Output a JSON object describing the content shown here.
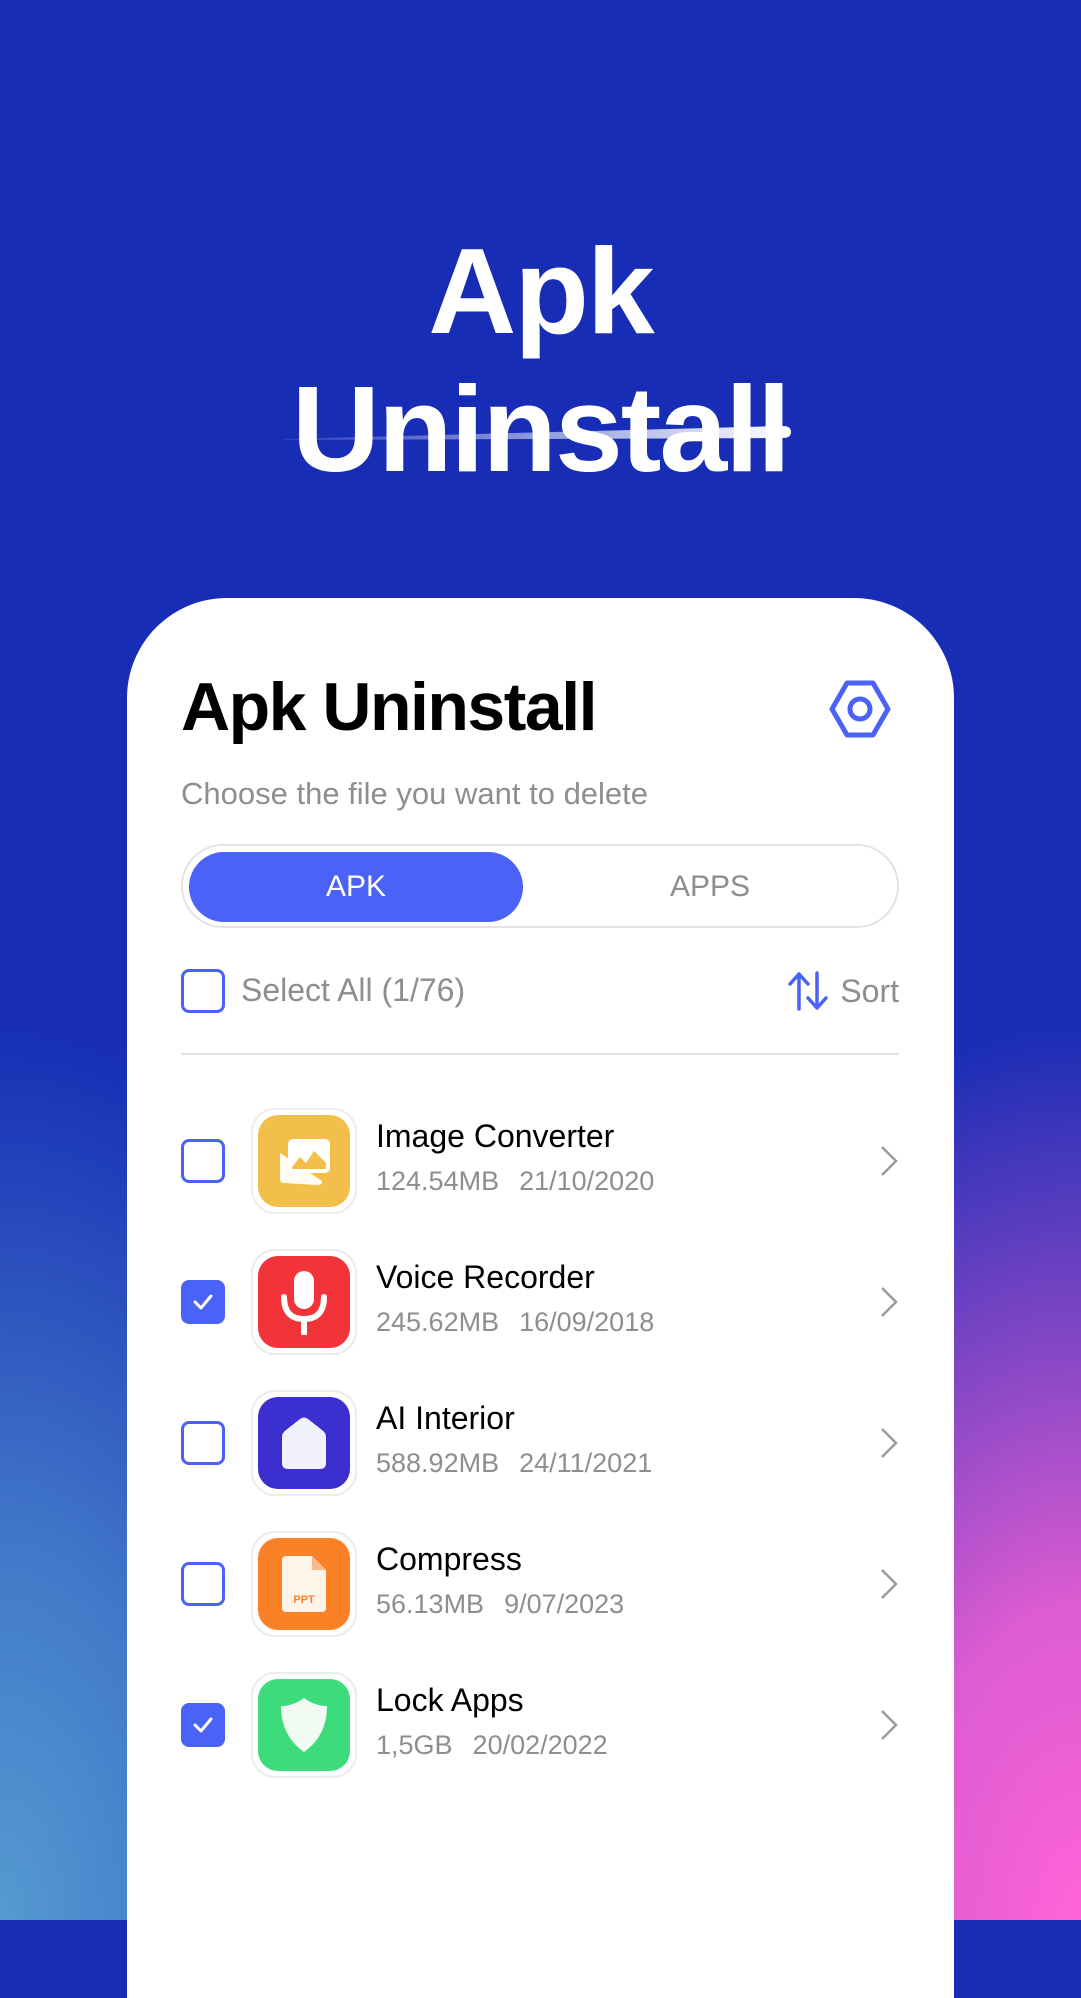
{
  "hero": {
    "title_line1": "Apk",
    "title_line2": "Uninstall"
  },
  "header": {
    "title": "Apk Uninstall",
    "subtitle": "Choose the file you want to delete",
    "settings_icon": "settings-hex-icon"
  },
  "tabs": [
    {
      "label": "APK",
      "active": true
    },
    {
      "label": "APPS",
      "active": false
    }
  ],
  "toolbar": {
    "select_all_label": "Select All (1/76)",
    "select_all_checked": false,
    "sort_label": "Sort",
    "sort_icon": "sort-arrows-icon"
  },
  "apps": [
    {
      "name": "Image Converter",
      "size": "124.54MB",
      "date": "21/10/2020",
      "checked": false,
      "icon": "image-gallery-icon",
      "color": "#f2c04a"
    },
    {
      "name": "Voice Recorder",
      "size": "245.62MB",
      "date": "16/09/2018",
      "checked": true,
      "icon": "microphone-icon",
      "color": "#f2333a"
    },
    {
      "name": "AI Interior",
      "size": "588.92MB",
      "date": "24/11/2021",
      "checked": false,
      "icon": "house-icon",
      "color": "#3b2fcf"
    },
    {
      "name": "Compress",
      "size": "56.13MB",
      "date": "9/07/2023",
      "checked": false,
      "icon": "ppt-file-icon",
      "icon_text": "PPT",
      "color": "#fb8127"
    },
    {
      "name": "Lock Apps",
      "size": "1,5GB",
      "date": "20/02/2022",
      "checked": true,
      "icon": "shield-icon",
      "color": "#3ddc7a"
    }
  ],
  "colors": {
    "accent": "#4a62f5",
    "background_top": "#172db5",
    "background_bottom_right": "#ff64d7",
    "background_bottom_left": "#559bd2",
    "muted_text": "#8e8e8e"
  }
}
